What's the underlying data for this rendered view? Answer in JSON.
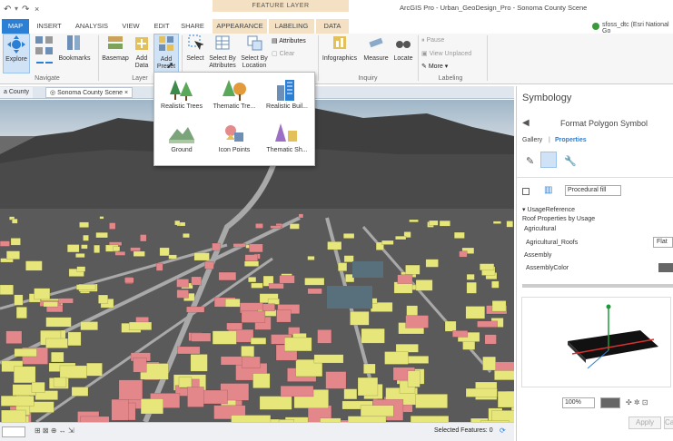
{
  "titlebar": {
    "title": "ArcGIS Pro - Urban_GeoDesign_Pro - Sonoma County Scene",
    "context_header": "FEATURE LAYER",
    "user": "sfoss_dtc (Esri National Go"
  },
  "tabs": [
    "MAP",
    "INSERT",
    "ANALYSIS",
    "VIEW",
    "EDIT",
    "SHARE",
    "APPEARANCE",
    "LABELING",
    "DATA"
  ],
  "ribbon": {
    "explore": "Explore",
    "bookmarks": "Bookmarks",
    "navigate_group": "Navigate",
    "basemap": "Basemap",
    "add_data": "Add Data",
    "add_preset": "Add Preset",
    "layer_group": "Layer",
    "select": "Select",
    "select_by_attributes": "Select By Attributes",
    "select_by_location": "Select By Location",
    "attributes": "Attributes",
    "clear": "Clear",
    "infographics": "Infographics",
    "measure": "Measure",
    "locate": "Locate",
    "inquiry_group": "Inquiry",
    "pause": "Pause",
    "view_unplaced": "View Unplaced",
    "more": "More",
    "labeling_group": "Labeling"
  },
  "preset_gallery": [
    {
      "label": "Realistic Trees",
      "icon": "trees-icon"
    },
    {
      "label": "Thematic Tre...",
      "icon": "thematic-trees-icon"
    },
    {
      "label": "Realistic Buil...",
      "icon": "realistic-buildings-icon"
    },
    {
      "label": "Ground",
      "icon": "ground-icon"
    },
    {
      "label": "Icon Points",
      "icon": "icon-points-icon"
    },
    {
      "label": "Thematic Sh...",
      "icon": "thematic-shapes-icon"
    }
  ],
  "doc_tabs": [
    "a County",
    "Sonoma County Scene"
  ],
  "status": {
    "selected_features": "Selected Features: 0"
  },
  "symbology": {
    "title": "Symbology",
    "subtitle": "Format Polygon Symbol",
    "gallery_tab": "Gallery",
    "properties_tab": "Properties",
    "layer_type": "Procedural fill",
    "usage_reference": "UsageReference",
    "roof_props": "Roof Properties by Usage",
    "agricultural": "Agricultural",
    "agricultural_roofs": "Agricultural_Roofs",
    "flat": "Flat",
    "assembly": "Assembly",
    "assembly_color": "AssemblyColor",
    "zoom": "100%",
    "apply": "Apply",
    "cancel": "Ca"
  },
  "colors": {
    "accent": "#2b7fd4",
    "yellow_building": "#e7e67a",
    "pink_building": "#e4878a",
    "blue_building": "#57707c"
  }
}
